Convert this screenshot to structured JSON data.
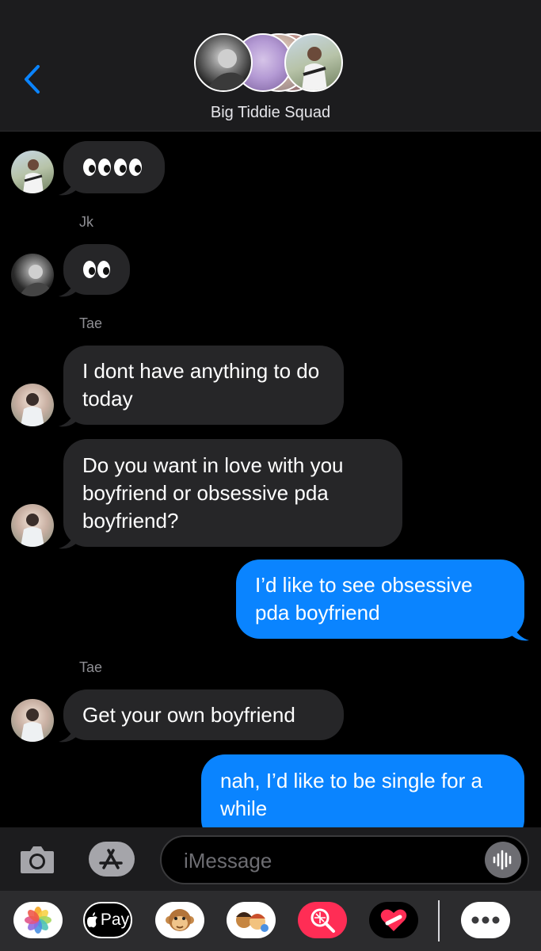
{
  "header": {
    "back_icon": "chevron-left-icon",
    "title": "Big Tiddie Squad",
    "accent": "#0a84ff",
    "avatars": [
      "person-dark-avatar",
      "person-purple-avatar",
      "person-light-avatar",
      "person-pink-avatar",
      "person-outdoor-avatar"
    ]
  },
  "messages": [
    {
      "type": "incoming",
      "text": "👀👀",
      "avatar": "person-outdoor-avatar"
    },
    {
      "type": "sender",
      "name": "Jk"
    },
    {
      "type": "incoming",
      "text": "👀",
      "avatar": "person-dark-avatar"
    },
    {
      "type": "sender",
      "name": "Tae"
    },
    {
      "type": "incoming",
      "text": "I dont have anything to do today",
      "avatar": "person-light-avatar"
    },
    {
      "type": "incoming",
      "text": "Do you want in love with you boyfriend or obsessive pda boyfriend?",
      "avatar": "person-light-avatar"
    },
    {
      "type": "outgoing",
      "text": "I’d like to see obsessive pda boyfriend"
    },
    {
      "type": "sender",
      "name": "Tae"
    },
    {
      "type": "incoming",
      "text": "Get your own boyfriend",
      "avatar": "person-light-avatar"
    },
    {
      "type": "outgoing",
      "text": "nah, I’d like to be single for a while"
    }
  ],
  "input": {
    "placeholder": "iMessage",
    "camera_icon": "camera-icon",
    "appstore_icon": "app-store-icon",
    "audio_icon": "audio-waveform-icon"
  },
  "app_drawer": [
    {
      "name": "photos-icon"
    },
    {
      "name": "apple-pay-icon",
      "label": "Pay"
    },
    {
      "name": "animoji-monkey-icon"
    },
    {
      "name": "memoji-icon"
    },
    {
      "name": "image-search-icon"
    },
    {
      "name": "heart-sticker-icon"
    },
    {
      "name": "more-apps-icon"
    }
  ]
}
